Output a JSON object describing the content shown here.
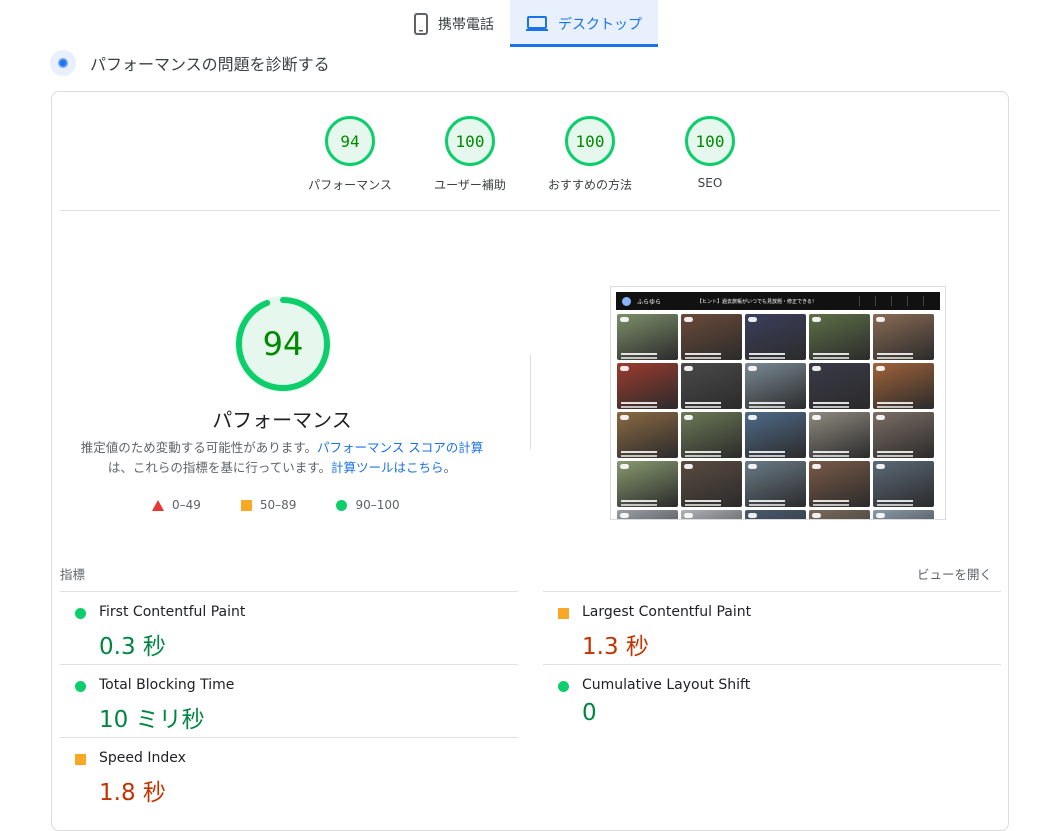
{
  "tabs": [
    {
      "label": "携帯電話",
      "icon": "phone-icon",
      "active": false
    },
    {
      "label": "デスクトップ",
      "icon": "laptop-icon",
      "active": true
    }
  ],
  "diagnose_title": "パフォーマンスの問題を診断する",
  "category_scores": [
    {
      "score": "94",
      "label": "パフォーマンス"
    },
    {
      "score": "100",
      "label": "ユーザー補助"
    },
    {
      "score": "100",
      "label": "おすすめの方法"
    },
    {
      "score": "100",
      "label": "SEO"
    }
  ],
  "main_gauge": {
    "score": "94",
    "score_fraction": 0.94,
    "label": "パフォーマンス",
    "color": "#0cce6b"
  },
  "description": {
    "text1": "推定値のため変動する可能性があります。",
    "link1": "パフォーマンス スコアの計算",
    "text2": "は、これらの指標を基に行っています。",
    "link2": "計算ツールはこちら",
    "text3": "。"
  },
  "legend": [
    {
      "shape": "triangle",
      "range": "0–49",
      "color": "#e53935"
    },
    {
      "shape": "square",
      "range": "50–89",
      "color": "#f9a825"
    },
    {
      "shape": "circle",
      "range": "90–100",
      "color": "#0cce6b"
    }
  ],
  "metrics_header": {
    "label": "指標",
    "toggle": "ビューを開く"
  },
  "metrics": [
    {
      "name": "First Contentful Paint",
      "value": "0.3 秒",
      "status": "good"
    },
    {
      "name": "Largest Contentful Paint",
      "value": "1.3 秒",
      "status": "average"
    },
    {
      "name": "Total Blocking Time",
      "value": "10 ミリ秒",
      "status": "good"
    },
    {
      "name": "Cumulative Layout Shift",
      "value": "0",
      "status": "good"
    },
    {
      "name": "Speed Index",
      "value": "1.8 秒",
      "status": "average"
    }
  ],
  "preview": {
    "logo_text": "ふらゆら",
    "banner_text": "【ヒント】過去旅帳がいつでも見放題・修正できる！",
    "tile_colors": [
      "#7d8f6a",
      "#6b4a3a",
      "#3b3f5c",
      "#5e7048",
      "#8a6b55",
      "#9c3b2e",
      "#4a4a4a",
      "#7b8a95",
      "#3a3a48",
      "#a0633a",
      "#8b6a44",
      "#6c7a56",
      "#4f6b8a",
      "#8f8a80",
      "#7c6e66",
      "#889a70",
      "#5a4b3f",
      "#6a7b88",
      "#7a5a48",
      "#5b6a78",
      "#9aa0a6",
      "#b0b4b8",
      "#4a5a70",
      "#7a6a5a",
      "#8a9aaa"
    ]
  }
}
